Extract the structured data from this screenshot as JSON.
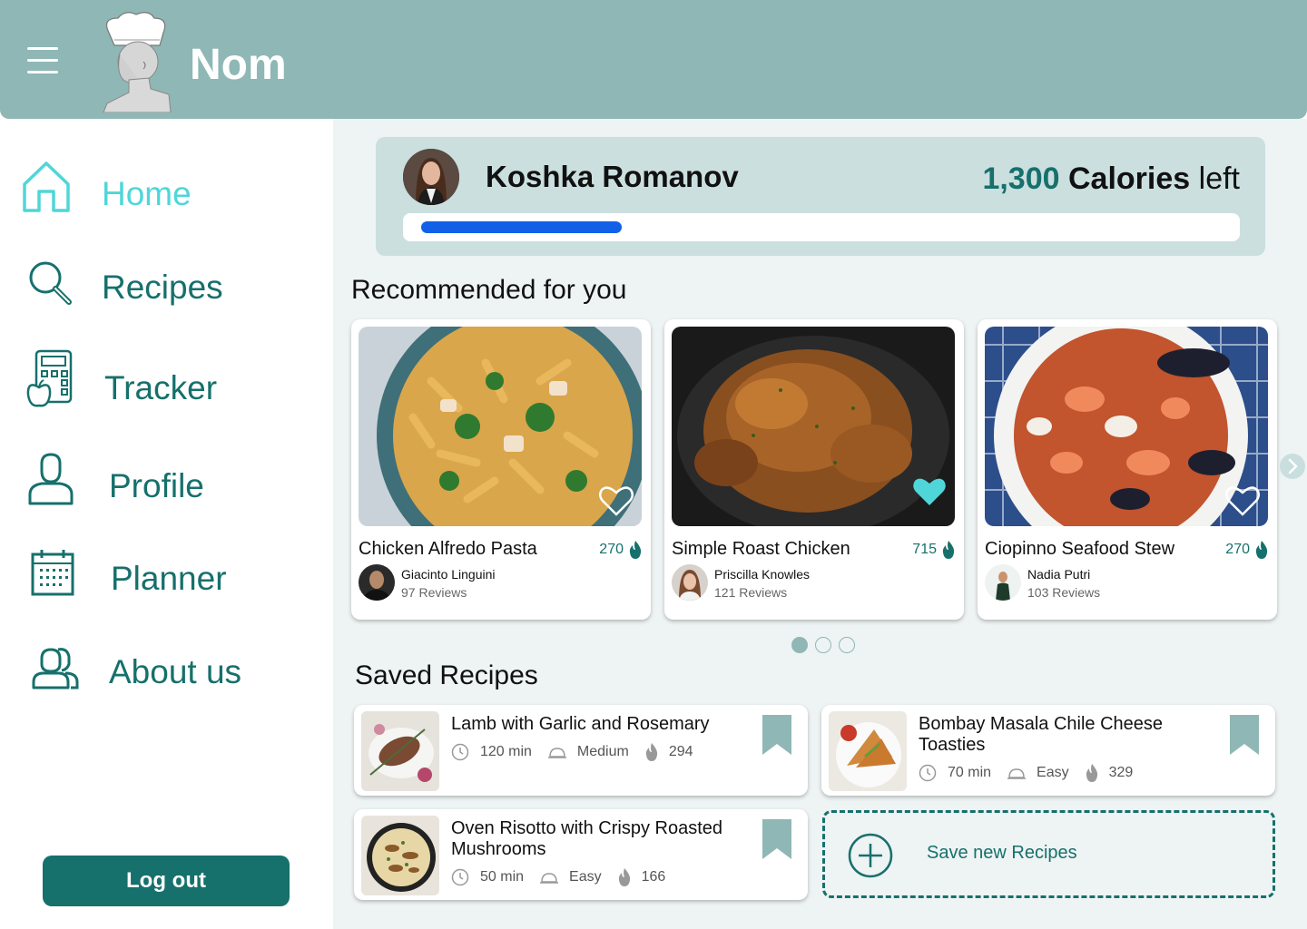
{
  "app": {
    "title": "Nom",
    "menu_icon": "hamburger-menu-icon",
    "logo": "chef-bust-logo"
  },
  "sidebar": {
    "items": [
      {
        "label": "Home",
        "icon": "home-icon",
        "active": true
      },
      {
        "label": "Recipes",
        "icon": "search-icon"
      },
      {
        "label": "Tracker",
        "icon": "calculator-apple-icon"
      },
      {
        "label": "Profile",
        "icon": "user-icon"
      },
      {
        "label": "Planner",
        "icon": "calendar-icon"
      },
      {
        "label": "About us",
        "icon": "group-icon"
      }
    ],
    "logout_label": "Log out"
  },
  "user": {
    "name": "Koshka Romanov",
    "calories_value": "1,300",
    "calories_word": "Calories",
    "calories_suffix": "left",
    "progress_fraction": 0.25
  },
  "recommended": {
    "title": "Recommended for you",
    "cards": [
      {
        "title": "Chicken Alfredo Pasta",
        "calories": "270",
        "author": "Giacinto Linguini",
        "reviews": "97 Reviews",
        "favorite": false
      },
      {
        "title": "Simple Roast Chicken",
        "calories": "715",
        "author": "Priscilla Knowles",
        "reviews": "121 Reviews",
        "favorite": true
      },
      {
        "title": "Ciopinno Seafood Stew",
        "calories": "270",
        "author": "Nadia Putri",
        "reviews": "103 Reviews",
        "favorite": false
      }
    ],
    "page_count": 3,
    "current_page": 1
  },
  "saved": {
    "title": "Saved Recipes",
    "items": [
      {
        "title": "Lamb with Garlic and Rosemary",
        "time": "120 min",
        "difficulty": "Medium",
        "calories": "294"
      },
      {
        "title": "Bombay Masala Chile Cheese Toasties",
        "time": "70 min",
        "difficulty": "Easy",
        "calories": "329"
      },
      {
        "title": "Oven Risotto with Crispy Roasted Mushrooms",
        "time": "50 min",
        "difficulty": "Easy",
        "calories": "166"
      }
    ],
    "add_label": "Save new Recipes"
  },
  "colors": {
    "header": "#8fb7b5",
    "primary": "#16706c",
    "active_nav": "#4fd6d9",
    "progress": "#1360e8",
    "user_card": "#cbdfdf",
    "main_bg": "#eef3f3"
  }
}
